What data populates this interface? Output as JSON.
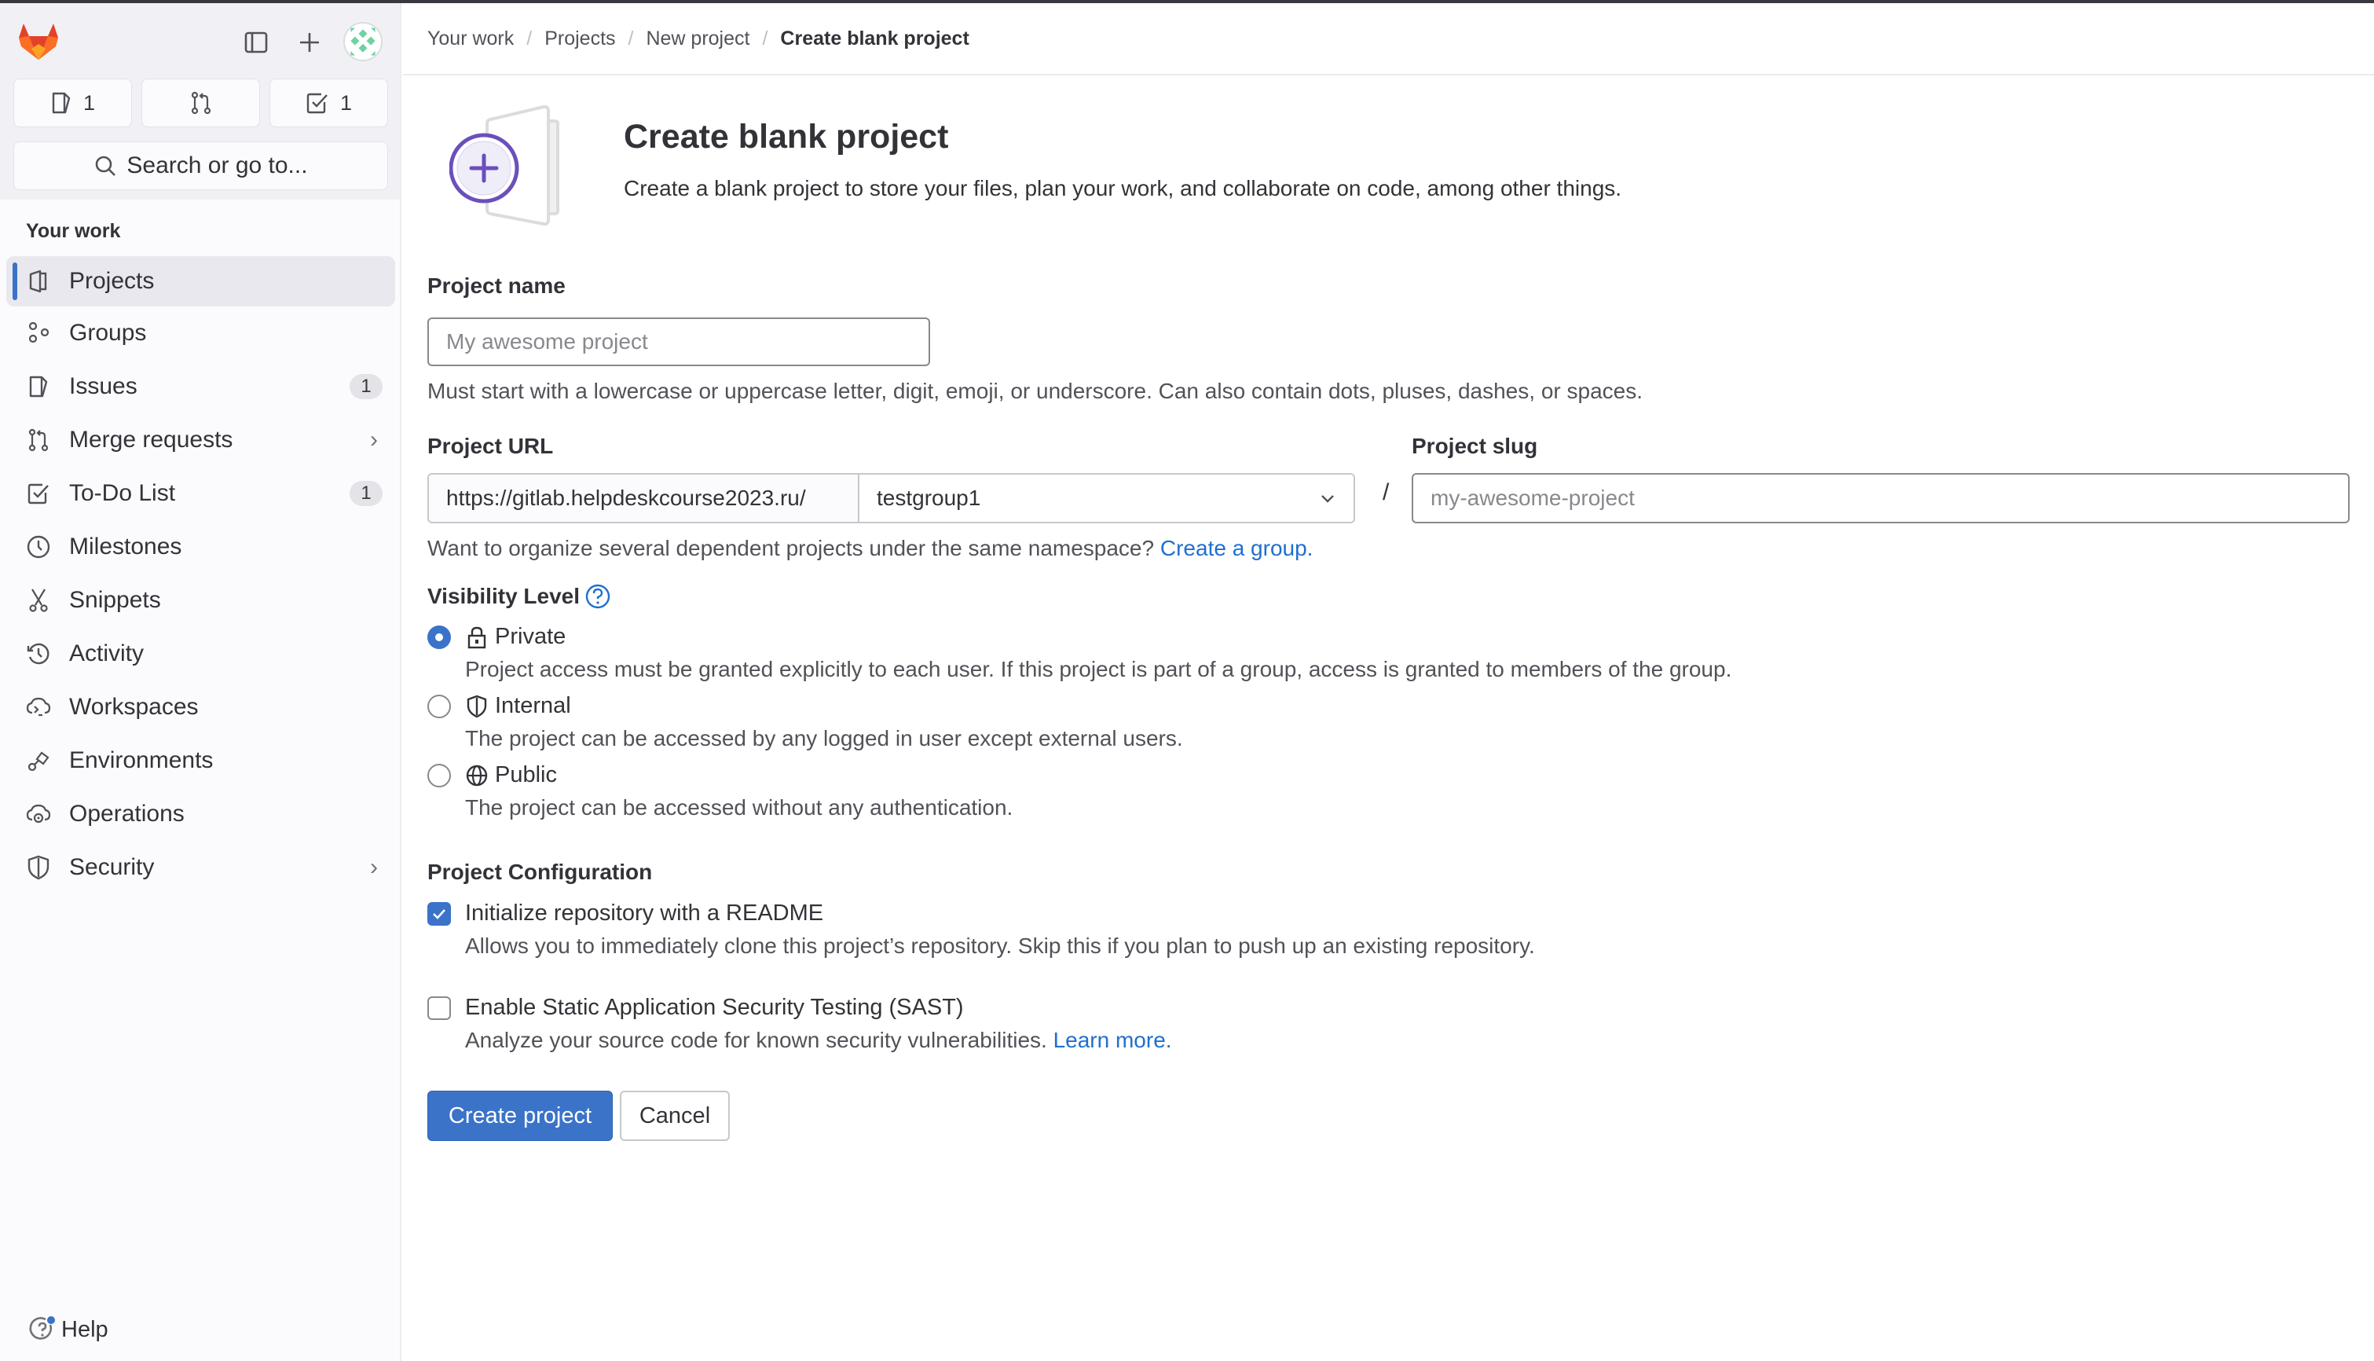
{
  "sidebar": {
    "counters": [
      {
        "icon": "issues-icon",
        "count": "1"
      },
      {
        "icon": "merge-request-icon",
        "count": ""
      },
      {
        "icon": "todo-icon",
        "count": "1"
      }
    ],
    "search_label": "Search or go to...",
    "section_title": "Your work",
    "items": [
      {
        "label": "Projects",
        "icon": "project-icon",
        "active": true,
        "badge": null,
        "chevron": false
      },
      {
        "label": "Groups",
        "icon": "group-icon",
        "active": false,
        "badge": null,
        "chevron": false
      },
      {
        "label": "Issues",
        "icon": "issues-icon",
        "active": false,
        "badge": "1",
        "chevron": false
      },
      {
        "label": "Merge requests",
        "icon": "merge-request-icon",
        "active": false,
        "badge": null,
        "chevron": true
      },
      {
        "label": "To-Do List",
        "icon": "todo-icon",
        "active": false,
        "badge": "1",
        "chevron": false
      },
      {
        "label": "Milestones",
        "icon": "clock-icon",
        "active": false,
        "badge": null,
        "chevron": false
      },
      {
        "label": "Snippets",
        "icon": "snippet-icon",
        "active": false,
        "badge": null,
        "chevron": false
      },
      {
        "label": "Activity",
        "icon": "history-icon",
        "active": false,
        "badge": null,
        "chevron": false
      },
      {
        "label": "Workspaces",
        "icon": "cloud-terminal-icon",
        "active": false,
        "badge": null,
        "chevron": false
      },
      {
        "label": "Environments",
        "icon": "environment-icon",
        "active": false,
        "badge": null,
        "chevron": false
      },
      {
        "label": "Operations",
        "icon": "cloud-gear-icon",
        "active": false,
        "badge": null,
        "chevron": false
      },
      {
        "label": "Security",
        "icon": "shield-icon",
        "active": false,
        "badge": null,
        "chevron": true
      }
    ],
    "help_label": "Help"
  },
  "breadcrumb": [
    "Your work",
    "Projects",
    "New project",
    "Create blank project"
  ],
  "hero": {
    "title": "Create blank project",
    "description": "Create a blank project to store your files, plan your work, and collaborate on code, among other things."
  },
  "form": {
    "project_name": {
      "label": "Project name",
      "value": "",
      "placeholder": "My awesome project",
      "help": "Must start with a lowercase or uppercase letter, digit, emoji, or underscore. Can also contain dots, pluses, dashes, or spaces."
    },
    "project_url": {
      "label": "Project URL",
      "prefix": "https://gitlab.helpdeskcourse2023.ru/",
      "namespace": "testgroup1",
      "separator": "/",
      "help": "Want to organize several dependent projects under the same namespace?",
      "help_link": "Create a group."
    },
    "project_slug": {
      "label": "Project slug",
      "value": "",
      "placeholder": "my-awesome-project"
    },
    "visibility": {
      "label": "Visibility Level",
      "selected": "Private",
      "options": [
        {
          "label": "Private",
          "icon": "lock-icon",
          "description": "Project access must be granted explicitly to each user. If this project is part of a group, access is granted to members of the group."
        },
        {
          "label": "Internal",
          "icon": "shield-icon",
          "description": "The project can be accessed by any logged in user except external users."
        },
        {
          "label": "Public",
          "icon": "globe-icon",
          "description": "The project can be accessed without any authentication."
        }
      ]
    },
    "configuration": {
      "label": "Project Configuration",
      "options": [
        {
          "label": "Initialize repository with a README",
          "checked": true,
          "description": "Allows you to immediately clone this project’s repository. Skip this if you plan to push up an existing repository.",
          "link": ""
        },
        {
          "label": "Enable Static Application Security Testing (SAST)",
          "checked": false,
          "description": "Analyze your source code for known security vulnerabilities.",
          "link": "Learn more."
        }
      ]
    },
    "submit_label": "Create project",
    "cancel_label": "Cancel"
  },
  "colors": {
    "primary": "#3a73c8",
    "link": "#1f6fd0",
    "illustration": "#6b4fbb"
  }
}
